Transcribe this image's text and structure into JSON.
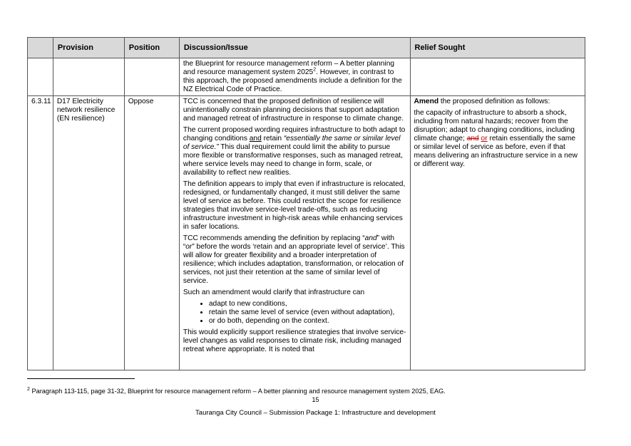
{
  "table": {
    "headers": [
      "",
      "Provision",
      "Position",
      "Discussion/Issue",
      "Relief Sought"
    ],
    "continuation": {
      "line1": "the Blueprint for resource management reform – A better planning and resource management system 2025",
      "sup": "2",
      "line2": ". However, in contrast to this approach, the proposed amendments include a definition for the NZ Electrical Code of Practice."
    },
    "row": {
      "ref": "6.3.11",
      "provision": "D17 Electricity network resilience (EN resilience)",
      "position": "Oppose",
      "discussion": {
        "p1": "TCC is concerned that the proposed definition of resilience will unintentionally constrain planning decisions that support adaptation and managed retreat of infrastructure in response to climate change.",
        "p2_a": "The current proposed wording requires infrastructure to both adapt to changing conditions ",
        "p2_and": "and",
        "p2_b": " retain ",
        "p2_quote": "“essentially the same or similar level of service.”",
        "p2_c": " This dual requirement could limit the ability to pursue more flexible or transformative responses, such as managed retreat, where service levels may need to change in form, scale, or availability to reflect new realities.",
        "p3": "The definition appears to imply that even if infrastructure is relocated, redesigned, or fundamentally changed, it must still deliver the same level of service as before. This could restrict the scope for resilience strategies that involve service-level trade-offs, such as reducing infrastructure investment in high-risk areas while enhancing services in safer locations.",
        "p4_a": "TCC recommends amending the definition by replacing “",
        "p4_and": "and",
        "p4_b": "” with “",
        "p4_or": "or",
        "p4_c": "” before the words ‘retain and an appropriate level of service’. This will allow for greater flexibility and a broader interpretation of resilience; which includes adaptation, transformation, or relocation of services, not just their retention at the same of similar level of service.",
        "p5": "Such an amendment would clarify that infrastructure can",
        "bullets": [
          "adapt to new conditions,",
          "retain the same level of service (even without adaptation),",
          "or do both, depending on the context."
        ],
        "p6": "This would explicitly support resilience strategies that involve service-level changes as valid responses to climate risk, including managed retreat where appropriate. It is noted that"
      },
      "relief": {
        "lead_bold": "Amend",
        "lead_rest": " the proposed definition as follows:",
        "def_a": "the capacity of infrastructure to absorb a shock, including from natural hazards; recover from the disruption; adapt to changing conditions, including climate change; ",
        "def_strike": "and",
        "def_space": " ",
        "def_ins": "or",
        "def_b": " retain essentially the same or similar level of service as before, even if that means delivering an infrastructure service in a new or different way."
      }
    }
  },
  "footnote": {
    "sup": "2",
    "text": " Paragraph 113-115, page 31-32, Blueprint for resource management reform – A better planning and resource management system 2025, EAG."
  },
  "page_number": "15",
  "footer": "Tauranga City Council – Submission Package 1: Infrastructure and development",
  "colors": {
    "header_bg": "#d9d9d9",
    "tracked_change": "#c00000"
  }
}
